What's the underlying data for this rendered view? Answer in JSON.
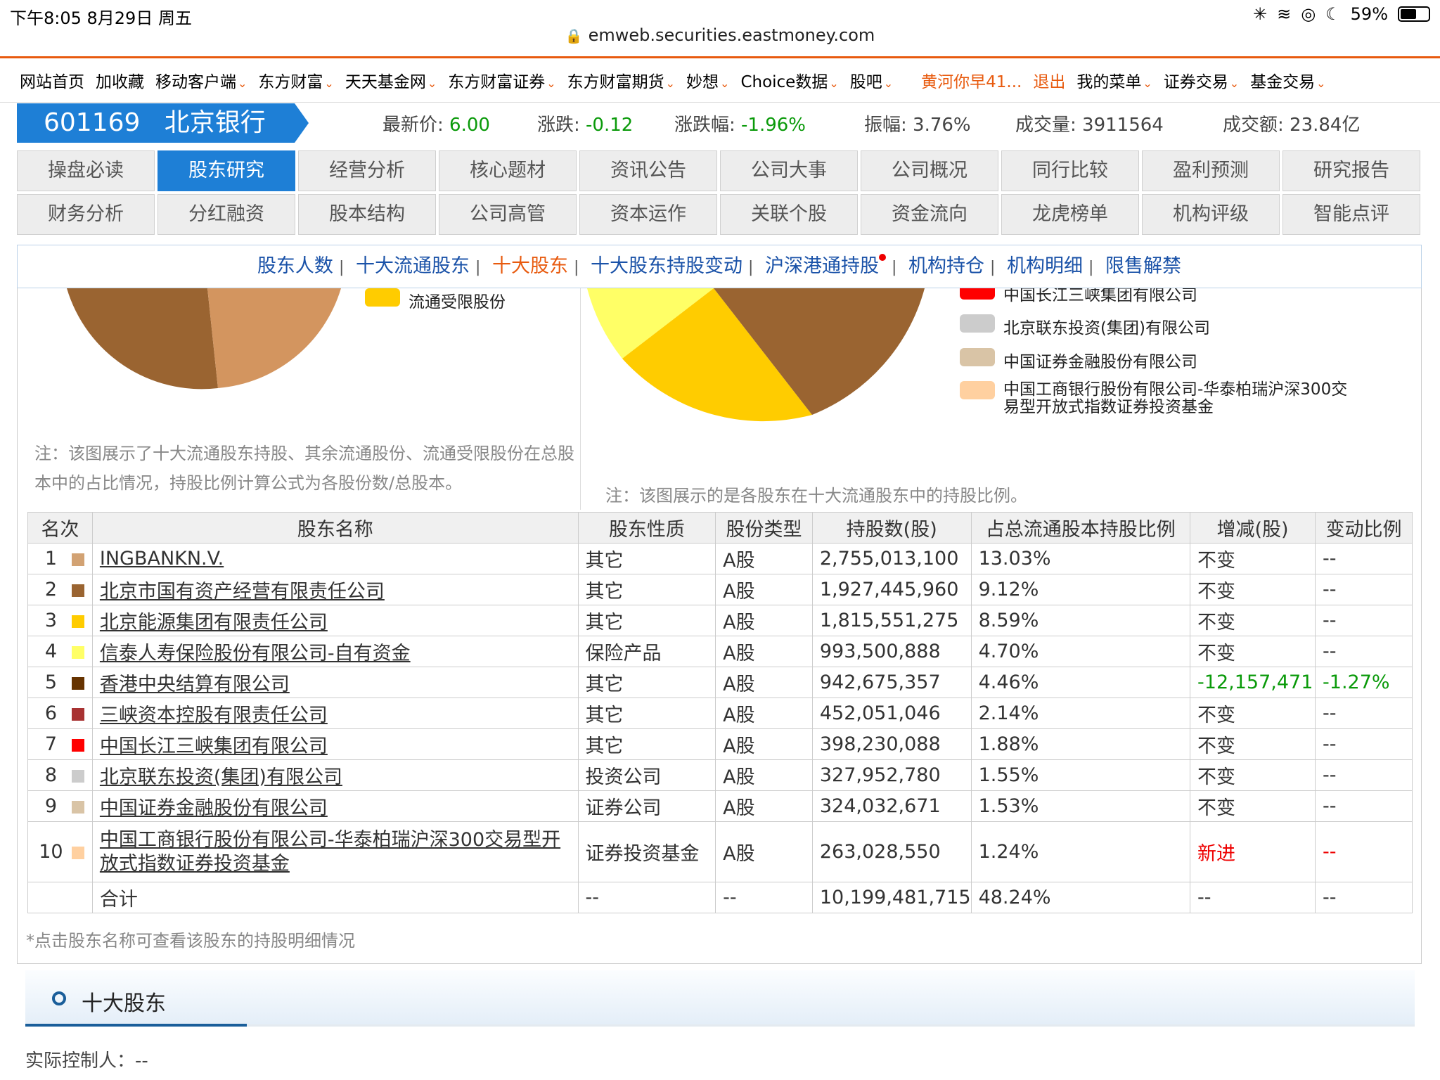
{
  "status_bar": {
    "time": "下午8:05   8月29日 周五",
    "battery": "59%",
    "battery_fill": 0.59
  },
  "url": "emweb.securities.eastmoney.com",
  "site_nav": {
    "items": [
      "网站首页",
      "加收藏",
      "移动客户端",
      "东方财富",
      "天天基金网",
      "东方财富证券",
      "东方财富期货",
      "妙想",
      "Choice数据",
      "股吧"
    ],
    "user": "黄河你早41...",
    "logout": "退出",
    "right_items": [
      "我的菜单",
      "证券交易",
      "基金交易"
    ]
  },
  "stock": {
    "code": "601169",
    "name": "北京银行",
    "quotes": [
      {
        "label": "最新价: ",
        "value": "6.00"
      },
      {
        "label": "涨跌: ",
        "value": "-0.12"
      },
      {
        "label": "涨跌幅: ",
        "value": "-1.96%"
      },
      {
        "label": "振幅: ",
        "value": "3.76%"
      },
      {
        "label": "成交量: ",
        "value": "3911564"
      },
      {
        "label": "成交额: ",
        "value": "23.84亿"
      }
    ]
  },
  "tabs_row1": [
    "操盘必读",
    "股东研究",
    "经营分析",
    "核心题材",
    "资讯公告",
    "公司大事",
    "公司概况",
    "同行比较",
    "盈利预测",
    "研究报告"
  ],
  "tabs_row2": [
    "财务分析",
    "分红融资",
    "股本结构",
    "公司高管",
    "资本运作",
    "关联个股",
    "资金流向",
    "龙虎榜单",
    "机构评级",
    "智能点评"
  ],
  "subnav": [
    "股东人数",
    "十大流通股东",
    "十大股东",
    "十大股东持股变动",
    "沪深港通持股",
    "机构持仓",
    "机构明细",
    "限售解禁"
  ],
  "left_chart": {
    "legend": [
      {
        "label": "流通受限股份",
        "color": "#ffcc00"
      }
    ],
    "note": "注：该图展示了十大流通股东持股、其余流通股份、流通受限股份在总股本中的占比情况，持股比例计算公式为各股份数/总股本。"
  },
  "right_chart": {
    "legend": [
      {
        "label": "中国长江三峡集团有限公司",
        "color": "#ff0000"
      },
      {
        "label": "北京联东投资(集团)有限公司",
        "color": "#cccccc"
      },
      {
        "label": "中国证券金融股份有限公司",
        "color": "#d9c4a6"
      },
      {
        "label": "中国工商银行股份有限公司-华泰柏瑞沪深300交易型开放式指数证券投资基金",
        "color": "#ffd0a0"
      }
    ],
    "note": "注：该图展示的是各股东在十大流通股东中的持股比例。"
  },
  "table": {
    "headers": [
      "名次",
      "股东名称",
      "股东性质",
      "股份类型",
      "持股数(股)",
      "占总流通股本持股比例",
      "增减(股)",
      "变动比例"
    ],
    "rows": [
      {
        "rank": "1",
        "color": "#d2a273",
        "name": "INGBANKN.V.",
        "nature": "其它",
        "type": "A股",
        "shares": "2,755,013,100",
        "pct": "13.03%",
        "change": "不变",
        "ratio": "--",
        "cls": ""
      },
      {
        "rank": "2",
        "color": "#9a6431",
        "name": "北京市国有资产经营有限责任公司",
        "nature": "其它",
        "type": "A股",
        "shares": "1,927,445,960",
        "pct": "9.12%",
        "change": "不变",
        "ratio": "--",
        "cls": ""
      },
      {
        "rank": "3",
        "color": "#ffcc00",
        "name": "北京能源集团有限责任公司",
        "nature": "其它",
        "type": "A股",
        "shares": "1,815,551,275",
        "pct": "8.59%",
        "change": "不变",
        "ratio": "--",
        "cls": ""
      },
      {
        "rank": "4",
        "color": "#ffff66",
        "name": "信泰人寿保险股份有限公司-自有资金",
        "nature": "保险产品",
        "type": "A股",
        "shares": "993,500,888",
        "pct": "4.70%",
        "change": "不变",
        "ratio": "--",
        "cls": ""
      },
      {
        "rank": "5",
        "color": "#663300",
        "name": "香港中央结算有限公司",
        "nature": "其它",
        "type": "A股",
        "shares": "942,675,357",
        "pct": "4.46%",
        "change": "-12,157,471",
        "ratio": "-1.27%",
        "cls": "green"
      },
      {
        "rank": "6",
        "color": "#a83232",
        "name": "三峡资本控股有限责任公司",
        "nature": "其它",
        "type": "A股",
        "shares": "452,051,046",
        "pct": "2.14%",
        "change": "不变",
        "ratio": "--",
        "cls": ""
      },
      {
        "rank": "7",
        "color": "#ff0000",
        "name": "中国长江三峡集团有限公司",
        "nature": "其它",
        "type": "A股",
        "shares": "398,230,088",
        "pct": "1.88%",
        "change": "不变",
        "ratio": "--",
        "cls": ""
      },
      {
        "rank": "8",
        "color": "#cccccc",
        "name": "北京联东投资(集团)有限公司",
        "nature": "投资公司",
        "type": "A股",
        "shares": "327,952,780",
        "pct": "1.55%",
        "change": "不变",
        "ratio": "--",
        "cls": ""
      },
      {
        "rank": "9",
        "color": "#d9c4a6",
        "name": "中国证券金融股份有限公司",
        "nature": "证券公司",
        "type": "A股",
        "shares": "324,032,671",
        "pct": "1.53%",
        "change": "不变",
        "ratio": "--",
        "cls": ""
      },
      {
        "rank": "10",
        "color": "#ffd0a0",
        "name": "中国工商银行股份有限公司-华泰柏瑞沪深300交易型开放式指数证券投资基金",
        "nature": "证券投资基金",
        "type": "A股",
        "shares": "263,028,550",
        "pct": "1.24%",
        "change": "新进",
        "ratio": "--",
        "cls": "red"
      }
    ],
    "total": {
      "label": "合计",
      "nature": "--",
      "type": "--",
      "shares": "10,199,481,715",
      "pct": "48.24%",
      "change": "--",
      "ratio": "--"
    }
  },
  "footnote": "*点击股东名称可查看该股东的持股明细情况",
  "section": {
    "title": "十大股东",
    "controller_label": "实际控制人：",
    "controller_value": "--"
  }
}
